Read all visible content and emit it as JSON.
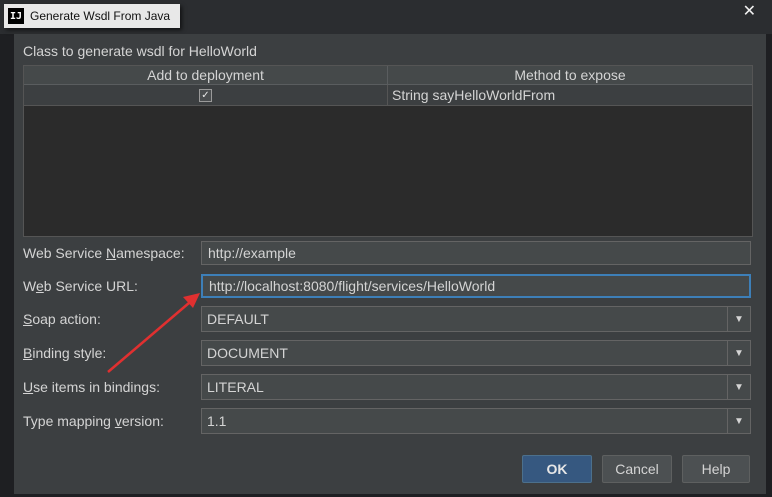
{
  "window": {
    "title": "Generate Wsdl From Java",
    "logo_text": "IJ",
    "close": "✕"
  },
  "dialog": {
    "heading": "Class to generate wsdl for HelloWorld",
    "table": {
      "columns": [
        "Add to deployment",
        "Method to expose"
      ],
      "rows": [
        {
          "checked": true,
          "method": "String sayHelloWorldFrom"
        }
      ]
    },
    "fields": {
      "namespace": {
        "label_pre": "Web Service ",
        "label_mn": "N",
        "label_post": "amespace:",
        "value": "http://example"
      },
      "url": {
        "label_pre": "W",
        "label_mn": "e",
        "label_post": "b Service URL:",
        "value": "http://localhost:8080/flight/services/HelloWorld"
      },
      "soap_action": {
        "label_pre": "",
        "label_mn": "S",
        "label_post": "oap action:",
        "value": "DEFAULT"
      },
      "binding_style": {
        "label_pre": "",
        "label_mn": "B",
        "label_post": "inding style:",
        "value": "DOCUMENT"
      },
      "use_items": {
        "label_pre": "",
        "label_mn": "U",
        "label_post": "se items in bindings:",
        "value": "LITERAL"
      },
      "type_mapping": {
        "label_pre": "Type mapping ",
        "label_mn": "v",
        "label_post": "ersion:",
        "value": "1.1"
      }
    },
    "buttons": {
      "ok": "OK",
      "cancel": "Cancel",
      "help": "Help"
    }
  },
  "colors": {
    "accent": "#365880",
    "focus_border": "#3d7fb8",
    "annotation_arrow": "#e03030"
  }
}
